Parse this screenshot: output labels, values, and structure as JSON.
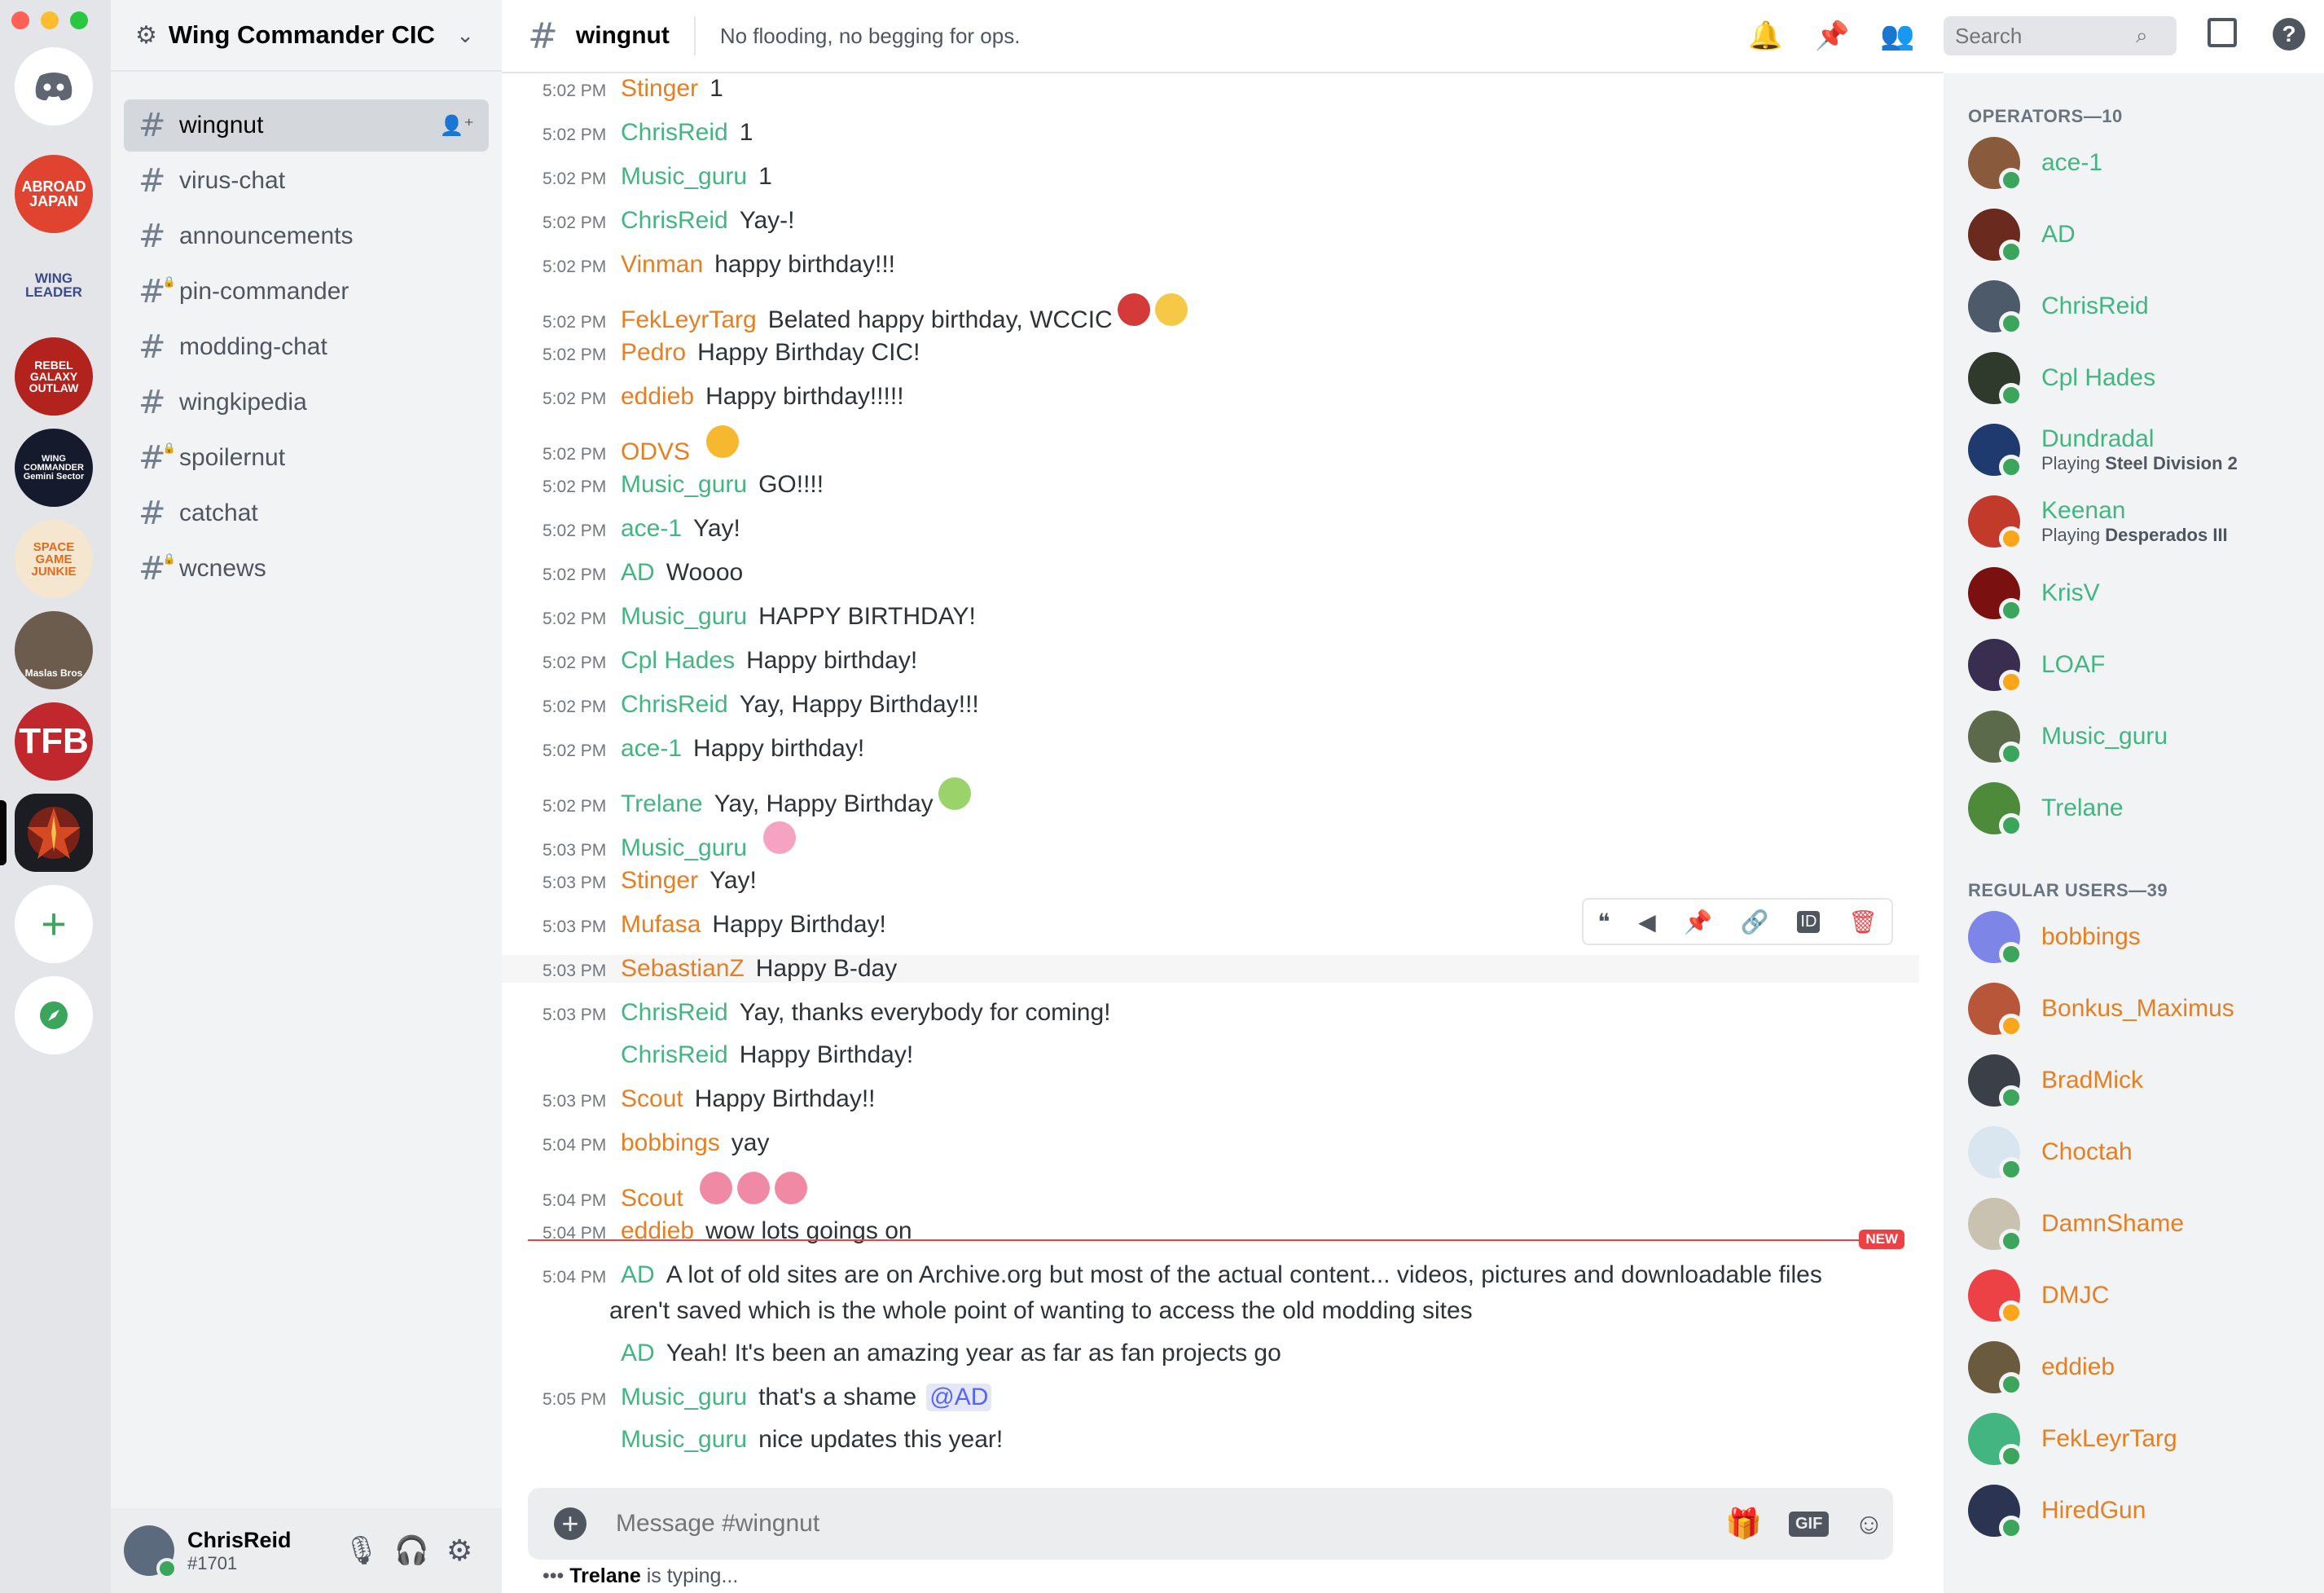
{
  "server": {
    "name": "Wing Commander CIC"
  },
  "channels": [
    {
      "name": "wingnut",
      "locked": false
    },
    {
      "name": "virus-chat",
      "locked": false
    },
    {
      "name": "announcements",
      "locked": false
    },
    {
      "name": "pin-commander",
      "locked": true
    },
    {
      "name": "modding-chat",
      "locked": false
    },
    {
      "name": "wingkipedia",
      "locked": false
    },
    {
      "name": "spoilernut",
      "locked": true
    },
    {
      "name": "catchat",
      "locked": false
    },
    {
      "name": "wcnews",
      "locked": true
    }
  ],
  "servers": [
    "ABROAD JAPAN",
    "WING LEADER",
    "REBEL GALAXY OUTLAW",
    "WING COMMANDER Gemini Sector",
    "SPACE GAME JUNKIE",
    "Maslas Bros",
    "TFB",
    "Wing Commander CIC"
  ],
  "user": {
    "name": "ChrisReid",
    "tag": "#1701"
  },
  "header": {
    "channel": "wingnut",
    "topic": "No flooding, no begging for ops.",
    "search_placeholder": "Search"
  },
  "messages": [
    {
      "time": "5:02 PM",
      "author": "Stinger",
      "text": "1",
      "color": "orange"
    },
    {
      "time": "5:02 PM",
      "author": "ChrisReid",
      "text": "1",
      "color": "green"
    },
    {
      "time": "5:02 PM",
      "author": "Music_guru",
      "text": "1",
      "color": "green"
    },
    {
      "time": "5:02 PM",
      "author": "ChrisReid",
      "text": "Yay-!",
      "color": "green"
    },
    {
      "time": "5:02 PM",
      "author": "Vinman",
      "text": "happy birthday!!!",
      "color": "orange"
    },
    {
      "time": "5:02 PM",
      "author": "FekLeyrTarg",
      "text": "Belated happy birthday, WCCIC",
      "color": "orange"
    },
    {
      "time": "5:02 PM",
      "author": "Pedro",
      "text": "Happy Birthday CIC!",
      "color": "orange"
    },
    {
      "time": "5:02 PM",
      "author": "eddieb",
      "text": "Happy birthday!!!!!",
      "color": "orange"
    },
    {
      "time": "5:02 PM",
      "author": "ODVS",
      "text": "",
      "color": "orange"
    },
    {
      "time": "5:02 PM",
      "author": "Music_guru",
      "text": "GO!!!!",
      "color": "green"
    },
    {
      "time": "5:02 PM",
      "author": "ace-1",
      "text": "Yay!",
      "color": "green"
    },
    {
      "time": "5:02 PM",
      "author": "AD",
      "text": "Woooo",
      "color": "green"
    },
    {
      "time": "5:02 PM",
      "author": "Music_guru",
      "text": "HAPPY BIRTHDAY!",
      "color": "green"
    },
    {
      "time": "5:02 PM",
      "author": "Cpl Hades",
      "text": "Happy birthday!",
      "color": "green"
    },
    {
      "time": "5:02 PM",
      "author": "ChrisReid",
      "text": "Yay, Happy Birthday!!!",
      "color": "green"
    },
    {
      "time": "5:02 PM",
      "author": "ace-1",
      "text": "Happy birthday!",
      "color": "green"
    },
    {
      "time": "5:02 PM",
      "author": "Trelane",
      "text": "Yay, Happy Birthday",
      "color": "green"
    },
    {
      "time": "5:03 PM",
      "author": "Music_guru",
      "text": "",
      "color": "green"
    },
    {
      "time": "5:03 PM",
      "author": "Stinger",
      "text": "Yay!",
      "color": "orange"
    },
    {
      "time": "5:03 PM",
      "author": "Mufasa",
      "text": "Happy Birthday!",
      "color": "orange"
    },
    {
      "time": "5:03 PM",
      "author": "SebastianZ",
      "text": "Happy B-day",
      "color": "orange"
    },
    {
      "time": "5:03 PM",
      "author": "ChrisReid",
      "text": "Yay, thanks everybody for coming!",
      "color": "green"
    },
    {
      "time": "",
      "author": "ChrisReid",
      "text": "Happy Birthday!",
      "color": "green"
    },
    {
      "time": "5:03 PM",
      "author": "Scout",
      "text": "Happy Birthday!!",
      "color": "orange"
    },
    {
      "time": "5:04 PM",
      "author": "bobbings",
      "text": "yay",
      "color": "orange"
    },
    {
      "time": "5:04 PM",
      "author": "Scout",
      "text": "",
      "color": "orange"
    },
    {
      "time": "5:04 PM",
      "author": "eddieb",
      "text": "wow lots goings on",
      "color": "orange"
    },
    {
      "time": "5:04 PM",
      "author": "AD",
      "text": "A lot of old sites are on Archive.org but most of the actual content... videos, pictures and downloadable files",
      "color": "green"
    },
    {
      "time": "",
      "author": "",
      "text": "aren't saved which is the whole point of wanting to access the old modding sites",
      "color": "green"
    },
    {
      "time": "",
      "author": "AD",
      "text": "Yeah! It's been an amazing year as far as fan projects  go",
      "color": "green"
    },
    {
      "time": "5:05 PM",
      "author": "Music_guru",
      "text": "that's a shame",
      "color": "green"
    },
    {
      "time": "",
      "author": "Music_guru",
      "text": "nice updates this year!",
      "color": "green"
    }
  ],
  "mention": "@AD",
  "new_badge": "NEW",
  "composer": {
    "placeholder": "Message #wingnut",
    "gif_label": "GIF"
  },
  "typing": {
    "user": "Trelane",
    "suffix": " is typing..."
  },
  "member_groups": [
    {
      "title": "OPERATORS—10",
      "members": [
        {
          "name": "ace-1",
          "color": "green",
          "activity": "",
          "activity_bold": ""
        },
        {
          "name": "AD",
          "color": "green",
          "activity": "",
          "activity_bold": ""
        },
        {
          "name": "ChrisReid",
          "color": "green",
          "activity": "",
          "activity_bold": ""
        },
        {
          "name": "Cpl Hades",
          "color": "green",
          "activity": "",
          "activity_bold": ""
        },
        {
          "name": "Dundradal",
          "color": "green",
          "activity": "Playing ",
          "activity_bold": "Steel Division 2"
        },
        {
          "name": "Keenan",
          "color": "green",
          "activity": "Playing ",
          "activity_bold": "Desperados III"
        },
        {
          "name": "KrisV",
          "color": "green",
          "activity": "",
          "activity_bold": ""
        },
        {
          "name": "LOAF",
          "color": "green",
          "activity": "",
          "activity_bold": ""
        },
        {
          "name": "Music_guru",
          "color": "green",
          "activity": "",
          "activity_bold": ""
        },
        {
          "name": "Trelane",
          "color": "green",
          "activity": "",
          "activity_bold": ""
        }
      ]
    },
    {
      "title": "REGULAR USERS—39",
      "members": [
        {
          "name": "bobbings",
          "color": "orange",
          "activity": "",
          "activity_bold": ""
        },
        {
          "name": "Bonkus_Maximus",
          "color": "orange",
          "activity": "",
          "activity_bold": ""
        },
        {
          "name": "BradMick",
          "color": "orange",
          "activity": "",
          "activity_bold": ""
        },
        {
          "name": "Choctah",
          "color": "orange",
          "activity": "",
          "activity_bold": ""
        },
        {
          "name": "DamnShame",
          "color": "orange",
          "activity": "",
          "activity_bold": ""
        },
        {
          "name": "DMJC",
          "color": "orange",
          "activity": "",
          "activity_bold": ""
        },
        {
          "name": "eddieb",
          "color": "orange",
          "activity": "",
          "activity_bold": ""
        },
        {
          "name": "FekLeyrTarg",
          "color": "orange",
          "activity": "",
          "activity_bold": ""
        },
        {
          "name": "HiredGun",
          "color": "orange",
          "activity": "",
          "activity_bold": ""
        }
      ]
    }
  ],
  "colors": {
    "green": "#43b581",
    "orange": "#e67e22",
    "blurple": "#5865f2",
    "red": "#ed4245"
  }
}
